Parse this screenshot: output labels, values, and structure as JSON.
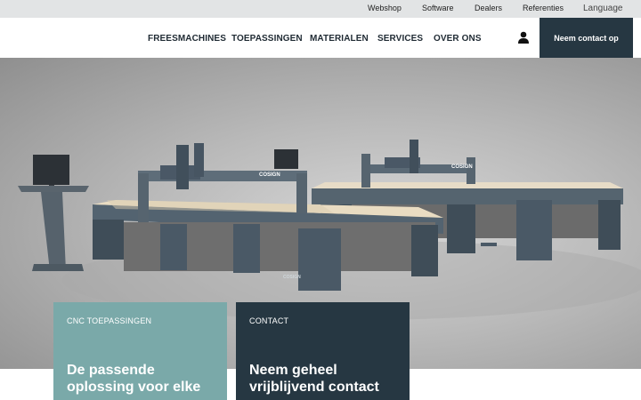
{
  "topbar": {
    "links": [
      "Webshop",
      "Software",
      "Dealers",
      "Referenties"
    ],
    "language": "Language"
  },
  "nav": {
    "items": [
      "FREESMACHINES",
      "TOEPASSINGEN",
      "MATERIALEN",
      "SERVICES",
      "OVER ONS"
    ],
    "cta": "Neem contact op"
  },
  "hero": {
    "brand_front": "COSIGN",
    "brand_back": "COSIGN"
  },
  "cards": [
    {
      "kicker": "CNC TOEPASSINGEN",
      "heading": "De passende oplossing voor elke"
    },
    {
      "kicker": "CONTACT",
      "heading": "Neem geheel vrijblijvend contact"
    }
  ],
  "colors": {
    "nav_dark": "#263742",
    "card_teal": "#7aa9a9",
    "machine_frame": "#4a5a66",
    "table_top": "#e6d9c3"
  }
}
